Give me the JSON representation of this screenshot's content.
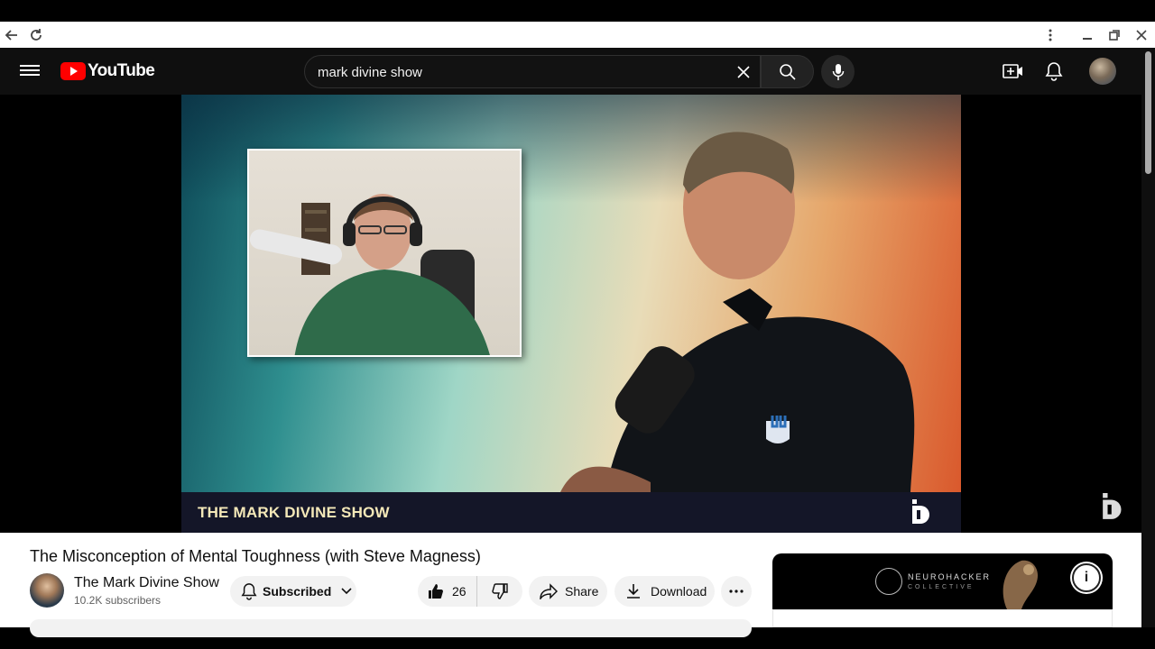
{
  "browser": {
    "back_icon": "arrow-left-icon",
    "reload_icon": "reload-icon",
    "menu_icon": "kebab-menu-icon",
    "minimize_icon": "minimize-icon",
    "restore_icon": "restore-icon",
    "close_icon": "close-icon"
  },
  "masthead": {
    "logo_text": "YouTube",
    "search_value": "mark divine show",
    "colors": {
      "background": "#0f0f0f",
      "logo_red": "#ff0000"
    }
  },
  "video": {
    "overlay_show_name": "THE MARK DIVINE SHOW"
  },
  "watch": {
    "title": "The Misconception of Mental Toughness (with Steve Magness)",
    "channel_name": "The Mark Divine Show",
    "subscribers": "10.2K subscribers",
    "subscribe_label": "Subscribed",
    "like_count": "26",
    "share_label": "Share",
    "download_label": "Download"
  },
  "ad": {
    "brand_line1": "NEUROHACKER",
    "brand_line2": "COLLECTIVE"
  }
}
